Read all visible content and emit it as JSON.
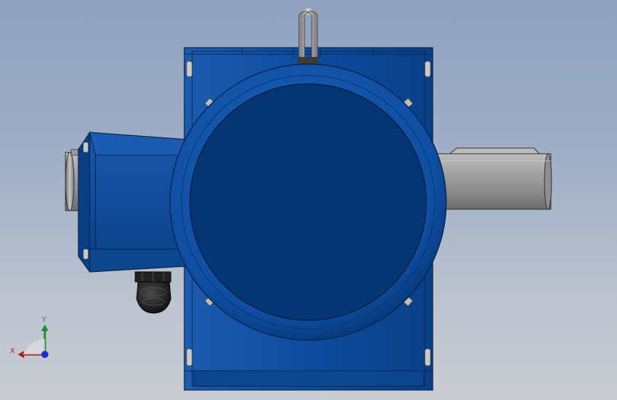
{
  "view": {
    "background_top": "#8ea1c0",
    "background_bottom": "#c9ccd2"
  },
  "model": {
    "body_color": "#0a4690",
    "body_dark": "#053572",
    "shaft_color": "#8d8d8d",
    "gland_color": "#1b1b1b",
    "eyebolt_color": "#b5b5b5"
  },
  "triad": {
    "x_label": "X",
    "y_label": "Y",
    "x_color": "#b01818",
    "y_color": "#1f8a2a",
    "z_color": "#1a2fd0"
  }
}
